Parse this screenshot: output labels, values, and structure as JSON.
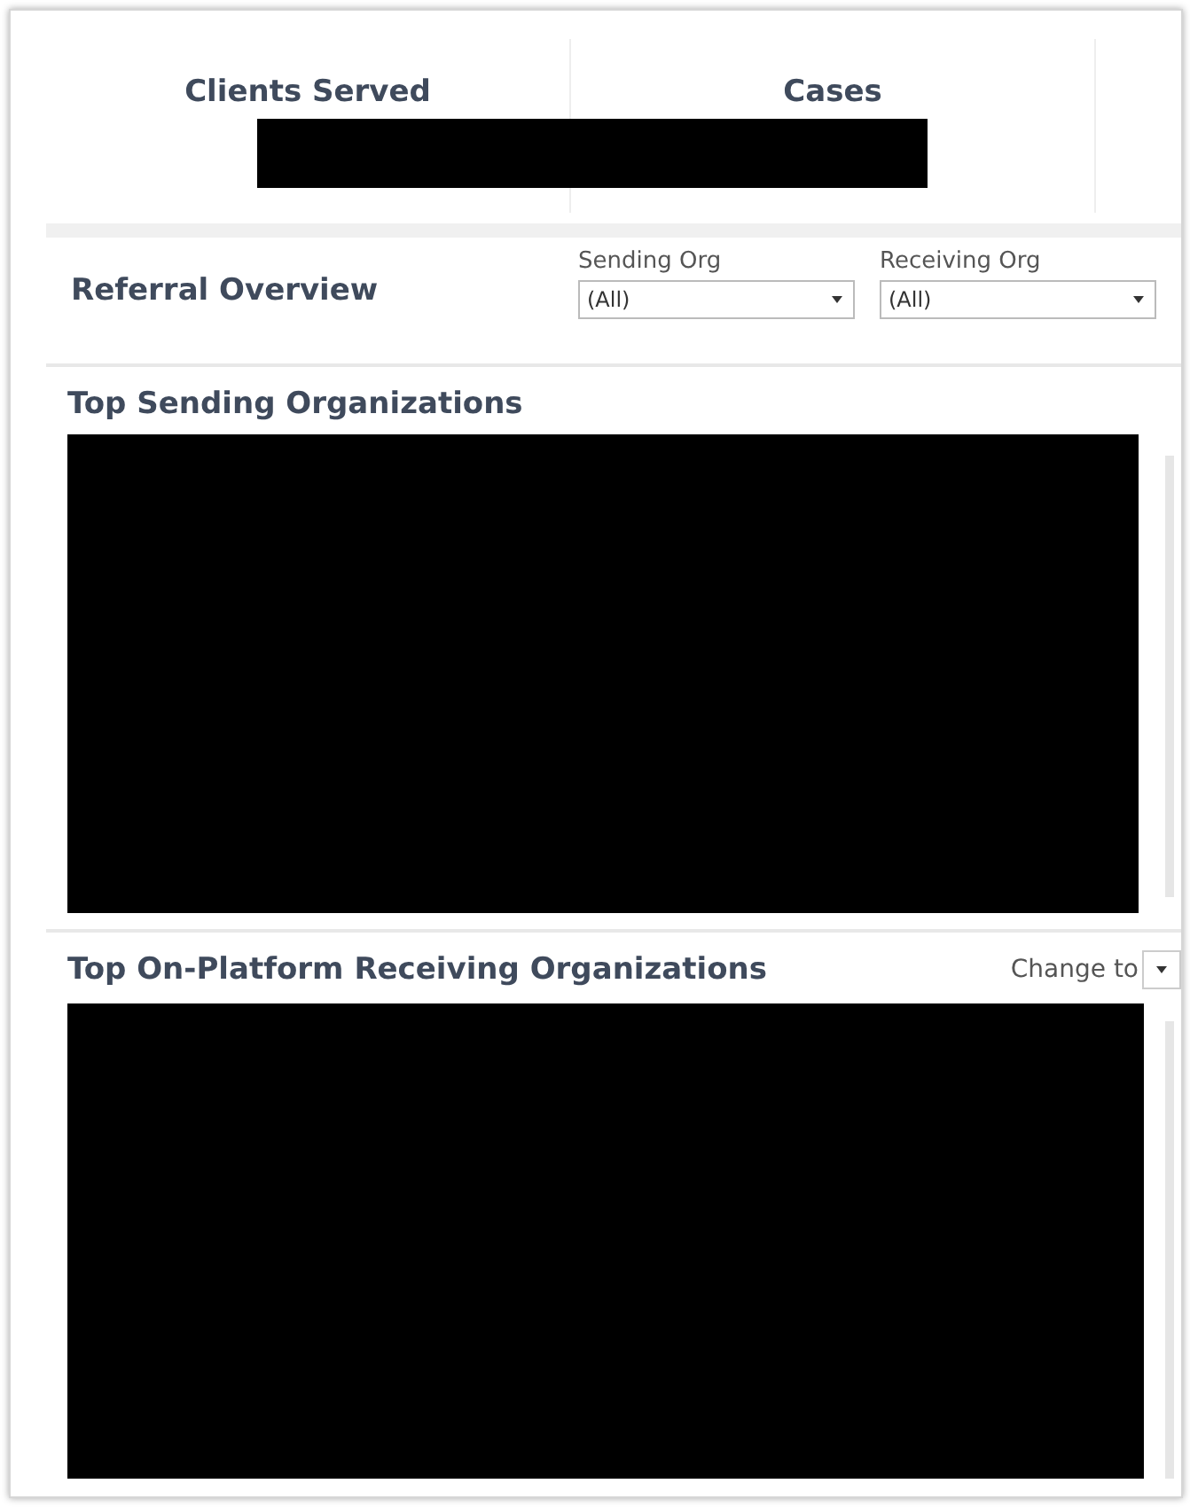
{
  "kpis": [
    {
      "label": "Clients Served"
    },
    {
      "label": "Cases"
    }
  ],
  "referral_overview": {
    "title": "Referral Overview",
    "filters": [
      {
        "label": "Sending Org",
        "value": "(All)"
      },
      {
        "label": "Receiving Org",
        "value": "(All)"
      }
    ]
  },
  "panels": [
    {
      "title": "Top Sending Organizations"
    },
    {
      "title": "Top On-Platform Receiving Organizations",
      "control": {
        "label": "Change to"
      }
    }
  ]
}
